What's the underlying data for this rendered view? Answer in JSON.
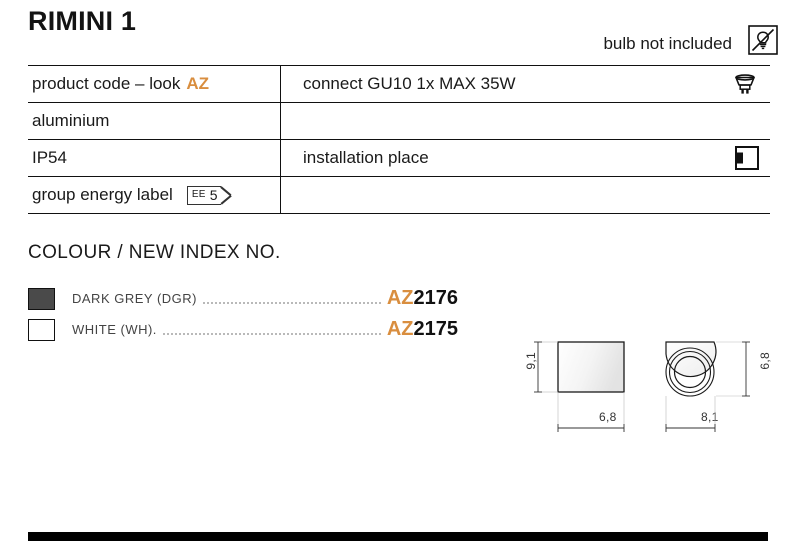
{
  "header": {
    "title": "RIMINI 1",
    "bulb_note": "bulb not included",
    "bulb_note_icon": "bulb-crossed-out-icon"
  },
  "spec_table": {
    "rows": [
      {
        "left_label": "product code – look",
        "left_accent": "AZ",
        "right_label": "connect GU10 1x MAX 35W",
        "right_icon": "gu10-lamp-icon"
      },
      {
        "left_label": "aluminium",
        "left_accent": "",
        "right_label": "",
        "right_icon": ""
      },
      {
        "left_label": "IP54",
        "left_accent": "",
        "right_label": "installation place",
        "right_icon": "wall-mount-icon"
      },
      {
        "left_label": "group energy label",
        "left_accent": "",
        "right_label": "",
        "right_icon": "",
        "badge": {
          "prefix": "EE",
          "value": "5"
        }
      }
    ]
  },
  "colour_section": {
    "heading": "COLOUR / NEW INDEX NO.",
    "items": [
      {
        "name": "DARK GREY (DGR)",
        "swatch_hex": "#4a4a4a",
        "code_prefix": "AZ",
        "code_number": "2176"
      },
      {
        "name": "WHITE (WH).",
        "swatch_hex": "#ffffff",
        "code_prefix": "AZ",
        "code_number": "2175"
      }
    ]
  },
  "drawings": {
    "front_view": {
      "name": "front-elevation",
      "height_label": "9,1",
      "width_label": "6,8"
    },
    "top_view": {
      "name": "plan-view",
      "height_label": "6,8",
      "width_label": "8,1"
    }
  },
  "colors": {
    "accent_orange": "#d98e3f",
    "line_black": "#111111",
    "dark_grey_swatch": "#4a4a4a"
  }
}
